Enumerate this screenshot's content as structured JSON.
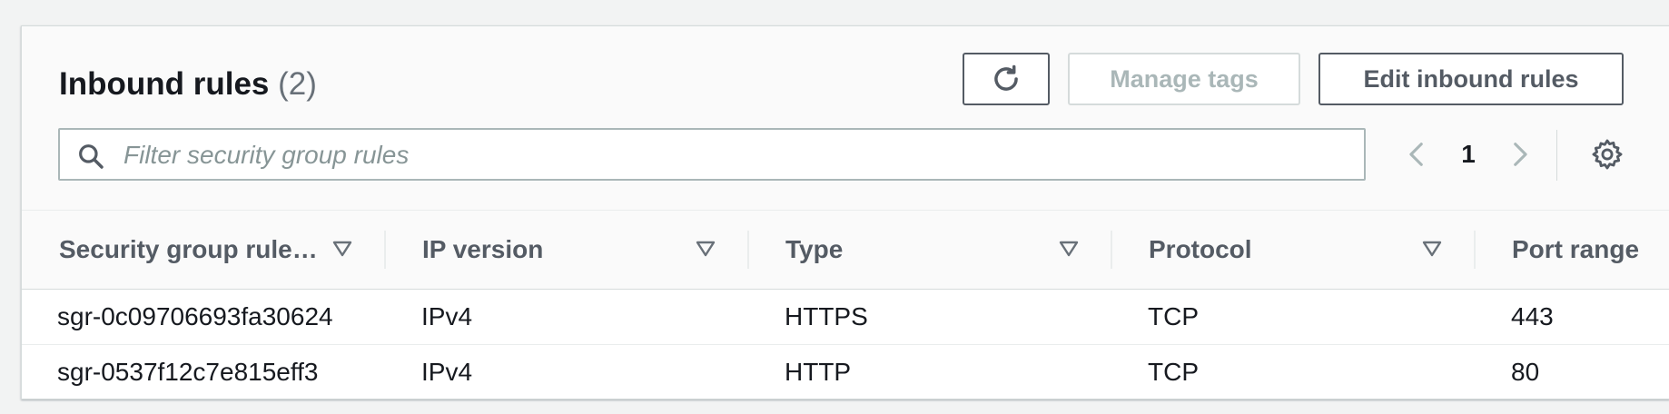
{
  "panel": {
    "title": "Inbound rules",
    "count": "(2)"
  },
  "buttons": {
    "refresh_icon": "refresh-icon",
    "manage_tags": "Manage tags",
    "edit_inbound_rules": "Edit inbound rules"
  },
  "search": {
    "placeholder": "Filter security group rules",
    "icon": "search-icon"
  },
  "pagination": {
    "current_page": "1",
    "prev_icon": "chevron-left-icon",
    "next_icon": "chevron-right-icon",
    "prev_disabled": true,
    "next_disabled": true
  },
  "settings_icon": "gear-icon",
  "table": {
    "columns": [
      {
        "label": "Security group rule…"
      },
      {
        "label": "IP version"
      },
      {
        "label": "Type"
      },
      {
        "label": "Protocol"
      },
      {
        "label": "Port range"
      }
    ],
    "rows": [
      [
        "sgr-0c09706693fa30624",
        "IPv4",
        "HTTPS",
        "TCP",
        "443"
      ],
      [
        "sgr-0537f12c7e815eff3",
        "IPv4",
        "HTTP",
        "TCP",
        "80"
      ]
    ]
  },
  "colors": {
    "background": "#f2f3f3",
    "text": "#16191f",
    "muted": "#687078",
    "disabled": "#aab7b8",
    "button_border": "#545b64"
  }
}
